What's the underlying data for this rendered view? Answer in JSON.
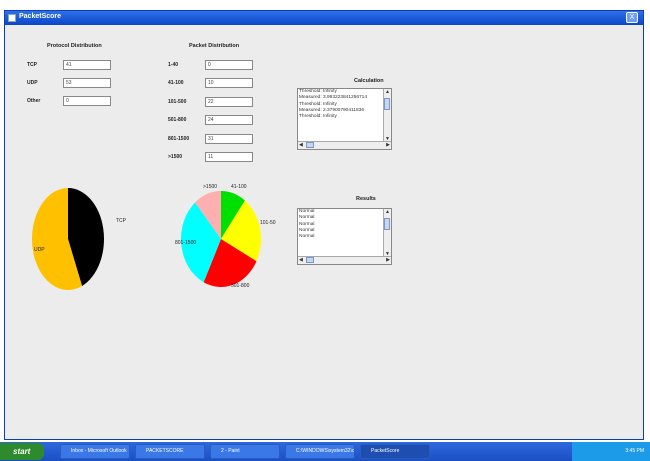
{
  "window": {
    "title": "PacketScore",
    "close_glyph": "X"
  },
  "protocol": {
    "heading": "Protocol Distribution",
    "rows": [
      {
        "label": "TCP",
        "value": "41"
      },
      {
        "label": "UDP",
        "value": "53"
      },
      {
        "label": "Other",
        "value": "0"
      }
    ]
  },
  "packet": {
    "heading": "Packet Distribution",
    "rows": [
      {
        "label": "1-40",
        "value": "0"
      },
      {
        "label": "41-100",
        "value": "10"
      },
      {
        "label": "101-500",
        "value": "22"
      },
      {
        "label": "501-800",
        "value": "24"
      },
      {
        "label": "801-1500",
        "value": "31"
      },
      {
        "label": ">1500",
        "value": "11"
      }
    ]
  },
  "calculation": {
    "heading": "Calculation",
    "lines": [
      "Threshold: Infinity",
      "Measured: 3.993223841256714",
      "Threshold: Infinity",
      "Measured: 2.37900790411836",
      "Threshold: Infinity"
    ]
  },
  "results": {
    "heading": "Results",
    "lines": [
      "Normal",
      "Normal",
      "Normal",
      "Normal",
      "Normal"
    ]
  },
  "chart_data": [
    {
      "type": "pie",
      "categories": [
        "TCP",
        "UDP"
      ],
      "values": [
        41,
        53
      ],
      "colors": [
        "#000000",
        "#ffc000"
      ]
    },
    {
      "type": "pie",
      "categories": [
        "41-100",
        "101-50",
        "501-800",
        "801-1500",
        ">1500"
      ],
      "values": [
        10,
        22,
        24,
        31,
        11
      ],
      "colors": [
        "#00e000",
        "#ffff00",
        "#ff0000",
        "#00ffff",
        "#ffafaf"
      ]
    }
  ],
  "taskbar": {
    "start": "start",
    "tasks": [
      "Inbox - Microsoft Outlook",
      "PACKETSCORE",
      "2 - Paint",
      "C:\\WINDOWS\\system32\\cmd",
      "PacketScore"
    ],
    "clock": "3:45 PM"
  }
}
